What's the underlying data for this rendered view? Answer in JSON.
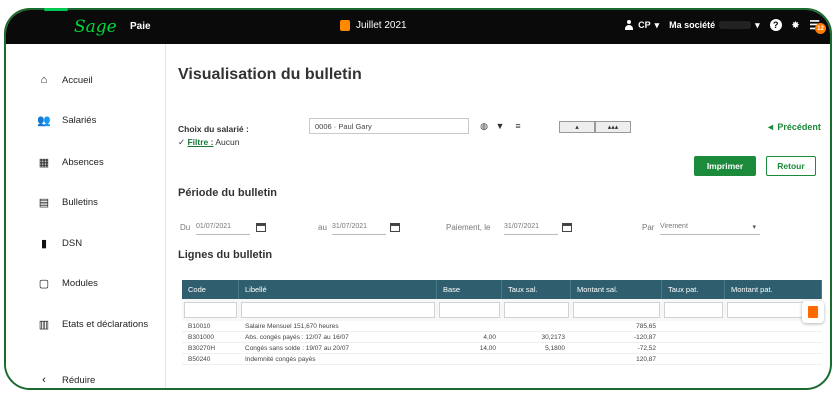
{
  "topbar": {
    "logo": "Sage",
    "app": "Paie",
    "period": "Juillet 2021",
    "user": "CP",
    "company": "Ma société",
    "help_icon": "help-icon",
    "notif_count": "12"
  },
  "sidebar": {
    "items": [
      {
        "label": "Accueil",
        "icon": "home-icon"
      },
      {
        "label": "Salariés",
        "icon": "people-icon"
      },
      {
        "label": "Absences",
        "icon": "calendar-icon"
      },
      {
        "label": "Bulletins",
        "icon": "document-icon"
      },
      {
        "label": "DSN",
        "icon": "file-icon"
      },
      {
        "label": "Modules",
        "icon": "module-icon"
      },
      {
        "label": "Etats et déclarations",
        "icon": "books-icon"
      },
      {
        "label": "Réduire",
        "icon": "chevron-left-icon"
      }
    ]
  },
  "main": {
    "title": "Visualisation du bulletin",
    "employee_label": "Choix du salarié :",
    "employee_value": "0006 · Paul Gary",
    "filter_label": "Filtre :",
    "filter_value": "Aucun",
    "previous": "◄ Précédent",
    "print_button": "Imprimer",
    "back_button": "Retour",
    "period_section": "Période du bulletin",
    "du_label": "Du",
    "du_value": "01/07/2021",
    "au_label": "au",
    "au_value": "31/07/2021",
    "payment_label": "Paiement, le",
    "payment_value": "31/07/2021",
    "par_label": "Par",
    "par_value": "Virement",
    "lines_section": "Lignes du bulletin"
  },
  "table": {
    "headers": [
      "Code",
      "Libellé",
      "Base",
      "Taux sal.",
      "Montant sal.",
      "Taux pat.",
      "Montant pat."
    ],
    "rows": [
      {
        "code": "B10010",
        "label": "Salaire Mensuel 151,670 heures",
        "base": "",
        "taux_sal": "",
        "montant_sal": "785,65",
        "taux_pat": "",
        "montant_pat": ""
      },
      {
        "code": "B301000",
        "label": "Abs. congés payés : 12/07 au 16/07",
        "base": "4,00",
        "taux_sal": "30,2173",
        "montant_sal": "-120,87",
        "taux_pat": "",
        "montant_pat": ""
      },
      {
        "code": "B30270H",
        "label": "Congés sans solde : 19/07 au 20/07",
        "base": "14,00",
        "taux_sal": "5,1800",
        "montant_sal": "-72,52",
        "taux_pat": "",
        "montant_pat": ""
      },
      {
        "code": "B50240",
        "label": "Indemnité congés payés",
        "base": "",
        "taux_sal": "",
        "montant_sal": "120,87",
        "taux_pat": "",
        "montant_pat": ""
      }
    ]
  },
  "colors": {
    "accent": "#1b8a3a",
    "table_header": "#2f5f6e",
    "brand": "#00d639",
    "frame": "#1b6a2e"
  }
}
